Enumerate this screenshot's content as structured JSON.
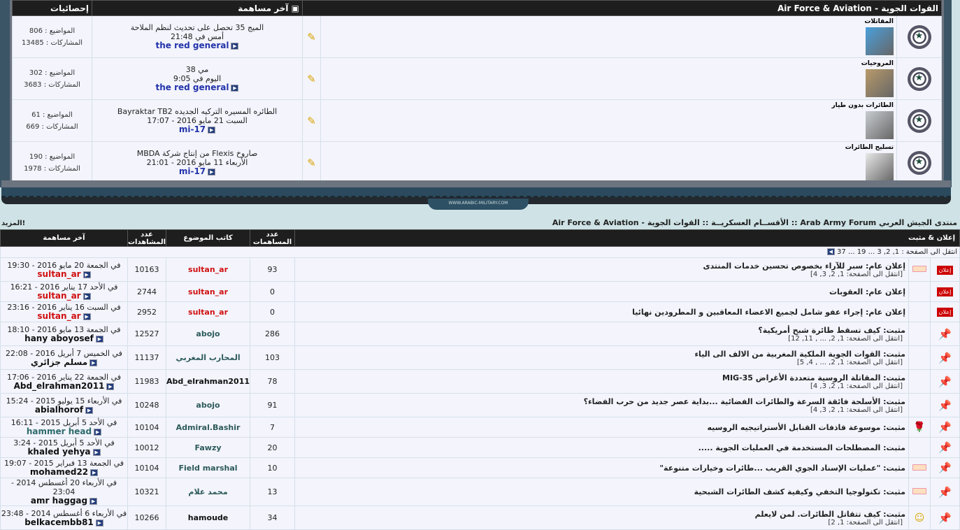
{
  "top": {
    "title": "القوات الجوية - Air Force & Aviation",
    "col_last": "آخر مساهمة",
    "col_stats": "إحصائيات",
    "forums": [
      {
        "name": "المقاتلات",
        "last_title": "الميج 35 تحصل على تحديث لنظم الملاحة",
        "last_date": "أمس في 21:48",
        "last_user": "the red general",
        "topics": "المواضيع : 806",
        "posts": "المشاركات : 13485",
        "thumb": "#4aa0dc"
      },
      {
        "name": "المروحيات",
        "last_title": "مي 38",
        "last_date": "اليوم في 9:05",
        "last_user": "the red general",
        "topics": "المواضيع : 302",
        "posts": "المشاركات : 3683",
        "thumb": "#b89a6a"
      },
      {
        "name": "الطائرات بدون طيار",
        "last_title": "الطائره المسيره التركيه الجديده Bayraktar TB2",
        "last_date": "السبت 21 مايو 2016 - 17:07",
        "last_user": "mi-17",
        "topics": "المواضيع : 61",
        "posts": "المشاركات : 669",
        "thumb": "#c8ccd0"
      },
      {
        "name": "تسليح الطائرات",
        "last_title": "صاروخ Flexis من إنتاج شركة MBDA",
        "last_date": "الأربعاء 11 مايو 2016 - 21:01",
        "last_user": "mi-17",
        "topics": "المواضيع : 190",
        "posts": "المشاركات : 1978",
        "thumb": "#e8e8e8"
      }
    ]
  },
  "banner": "WWW.ARABIC-MILITARY.COM",
  "breadcrumb": "منتدى الجيش العربي Arab Army Forum :: الأقســام العسكريــة :: القوات الجوية - Air Force & Aviation",
  "more": "المزيد!",
  "list": {
    "h_topic": "إعلان & مثبت",
    "h_replies": "عدد المساهمات",
    "h_author": "كاتب الموضوع",
    "h_views": "عدد المشاهدات",
    "h_last": "آخر مساهمة",
    "pagination": "انتقل الى الصفحة : 1, 2, 3 ... 19 ... 37",
    "badge": "إعلان",
    "rows": [
      {
        "type": "ann",
        "title": "إعلان عام: سبر للآراء بخصوص تحسين خدمات المنتدى",
        "pages": "[انتقل الى الصفحة: 1, 2, 3, 4]",
        "replies": "93",
        "author": "sultan_ar",
        "ac": "red",
        "views": "10163",
        "date": "في الجمعة 20 مايو 2016 - 19:30",
        "user": "sultan_ar",
        "uc": "red"
      },
      {
        "type": "ann",
        "title": "إعلان عام: العقوبات",
        "pages": "",
        "replies": "0",
        "author": "sultan_ar",
        "ac": "red",
        "views": "2744",
        "date": "في الأحد 17 يناير 2016 - 16:21",
        "user": "sultan_ar",
        "uc": "red"
      },
      {
        "type": "ann",
        "title": "إعلان عام: إجراء عفو شامل لجميع الاعضاء المعاقبين و المطرودين نهائيا",
        "pages": "",
        "replies": "0",
        "author": "sultan_ar",
        "ac": "red",
        "views": "2952",
        "date": "في السبت 16 يناير 2016 - 23:16",
        "user": "sultan_ar",
        "uc": "red"
      },
      {
        "type": "pin",
        "title": "مثبت: كيف تسقط طائرة شبح أمريكية؟",
        "pages": "[انتقل الى الصفحة: 1, 2, ... , 11, 12]",
        "replies": "286",
        "author": "abojo",
        "ac": "",
        "views": "12527",
        "date": "في الجمعة 13 مايو 2016 - 18:10",
        "user": "hany aboyosef",
        "uc": ""
      },
      {
        "type": "pin",
        "title": "مثبت: القوات الجوية الملكية المغربية من الالف الى الياء",
        "pages": "[انتقل الى الصفحة: 1, 2, ... , 4, 5]",
        "replies": "103",
        "author": "المحارب المغربي",
        "ac": "",
        "views": "11137",
        "date": "في الخميس 7 أبريل 2016 - 22:08",
        "user": "مسلم جزائري",
        "uc": ""
      },
      {
        "type": "pin",
        "title": "مثبت: المقاتلة الروسية متعددة الأغراض MIG-35",
        "pages": "[انتقل الى الصفحة: 1, 2, 3, 4]",
        "replies": "78",
        "author": "Abd_elrahman2011",
        "ac": "blk",
        "views": "11983",
        "date": "في الجمعة 22 يناير 2016 - 17:06",
        "user": "Abd_elrahman2011",
        "uc": ""
      },
      {
        "type": "pin",
        "title": "مثبت: الأسلحة فائقة السرعة والطائرات الفضائية ...بداية عصر جديد من حرب الفضاء؟",
        "pages": "[انتقل الى الصفحة: 1, 2, 3, 4]",
        "replies": "91",
        "author": "abojo",
        "ac": "",
        "views": "10248",
        "date": "في الأربعاء 15 يوليو 2015 - 15:24",
        "user": "abialhorof",
        "uc": ""
      },
      {
        "type": "pin",
        "title": "مثبت: موسوعة قاذفات القنابل الأستراتيجيه الروسيه",
        "pages": "",
        "replies": "7",
        "author": "Admiral.Bashir",
        "ac": "",
        "views": "10104",
        "date": "في الأحد 5 أبريل 2015 - 16:11",
        "user": "hammer head",
        "uc": "teal"
      },
      {
        "type": "pin",
        "title": "مثبت: المصطلحات المستخدمة في العمليات الجوية .....",
        "pages": "",
        "replies": "20",
        "author": "Fawzy",
        "ac": "",
        "views": "10012",
        "date": "في الأحد 5 أبريل 2015 - 3:24",
        "user": "khaled yehya",
        "uc": ""
      },
      {
        "type": "pin",
        "title": "مثبت: \"عمليات الإسناد الجوي القريب ...طائرات وخيارات متنوعة\"",
        "pages": "",
        "replies": "10",
        "author": "Field marshal",
        "ac": "",
        "views": "10104",
        "date": "في الجمعة 13 فبراير 2015 - 19:07",
        "user": "mohamed22",
        "uc": ""
      },
      {
        "type": "pin",
        "title": "مثبت: تكنولوجيا التخفي وكيفية كشف الطائرات الشبحية",
        "pages": "",
        "replies": "13",
        "author": "محمد علام",
        "ac": "",
        "views": "10321",
        "date": "في الأربعاء 20 أغسطس 2014 - 23:04",
        "user": "amr haggag",
        "uc": ""
      },
      {
        "type": "pin",
        "title": "مثبت: كيف تتقاتل الطائرات. لمن لايعلم",
        "pages": "[انتقل الى الصفحة: 1, 2]",
        "replies": "34",
        "author": "hamoude",
        "ac": "blk",
        "views": "10266",
        "date": "في الأربعاء 6 أغسطس 2014 - 23:48",
        "user": "belkacembb81",
        "uc": ""
      }
    ]
  }
}
